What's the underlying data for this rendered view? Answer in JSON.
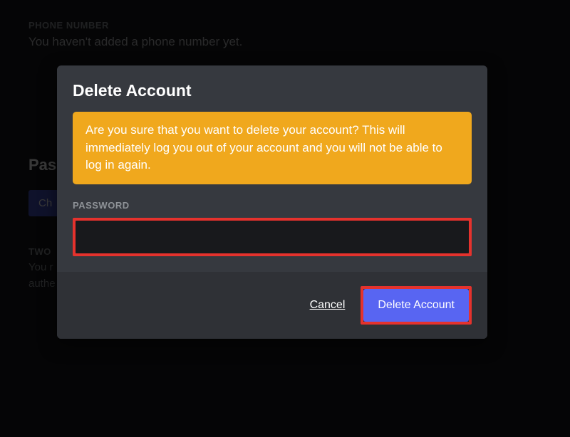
{
  "background": {
    "phone_label": "PHONE NUMBER",
    "phone_text": "You haven't added a phone number yet.",
    "password_heading": "Pas",
    "change_button": "Ch",
    "twofa_label": "TWO",
    "twofa_line1": "You r",
    "twofa_line2": "authe"
  },
  "modal": {
    "title": "Delete Account",
    "warning": "Are you sure that you want to delete your account? This will immediately log you out of your account and you will not be able to log in again.",
    "password_label": "PASSWORD",
    "password_value": "",
    "footer": {
      "cancel": "Cancel",
      "delete": "Delete Account"
    }
  }
}
